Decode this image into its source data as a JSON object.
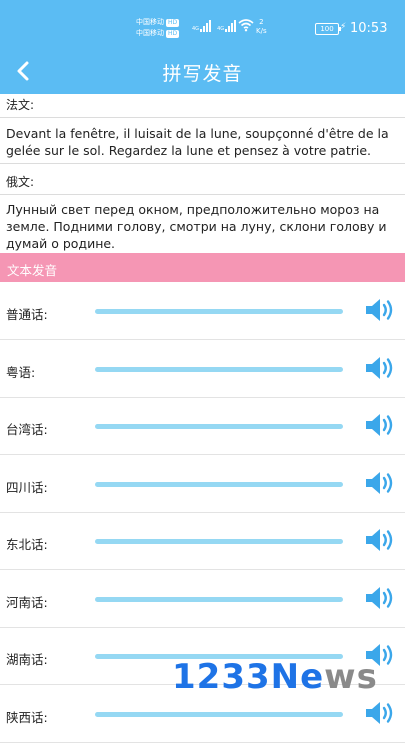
{
  "status_bar": {
    "carrier_1": "中国移动",
    "carrier_2": "中国移动",
    "hd": "HD",
    "net_type_1": "4G",
    "net_type_2": "4G",
    "speed_value": "2",
    "speed_unit": "K/s",
    "battery": "100",
    "time": "10:53"
  },
  "header": {
    "title": "拼写发音",
    "back_icon": "chevron-left-icon"
  },
  "french": {
    "label": "法文:",
    "text": "Devant la fenêtre, il luisait de la lune, soupçonné d'être de la gelée sur le sol. Regardez la lune et pensez à votre patrie."
  },
  "russian": {
    "label": "俄文:",
    "text": "Лунный свет перед окном, предположительно мороз на земле. Подними голову, смотри на луну, склони голову и думай о родине."
  },
  "section": {
    "title": "文本发音"
  },
  "dialects": [
    {
      "label": "普通话:"
    },
    {
      "label": "粤语:"
    },
    {
      "label": "台湾话:"
    },
    {
      "label": "四川话:"
    },
    {
      "label": "东北话:"
    },
    {
      "label": "河南话:"
    },
    {
      "label": "湖南话:"
    },
    {
      "label": "陕西话:"
    }
  ],
  "watermark": {
    "text_blue": "1233Ne",
    "text_gray": "ws"
  },
  "colors": {
    "primary": "#5bbcf3",
    "section": "#f596b4",
    "track": "#95d8f3",
    "speaker": "#3ba7ea"
  }
}
